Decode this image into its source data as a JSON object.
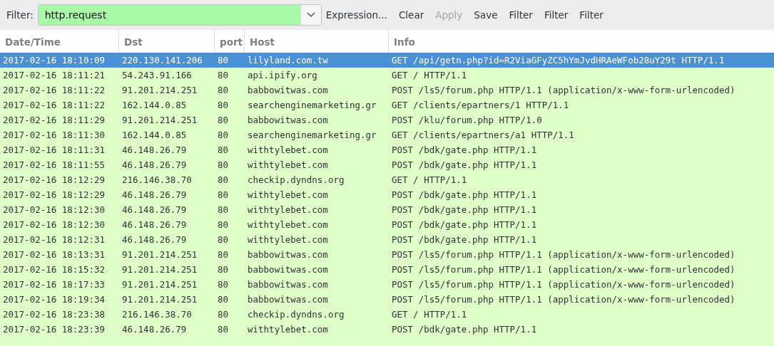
{
  "toolbar": {
    "label": "Filter:",
    "filter": {
      "value": "http.request",
      "valid": true
    },
    "buttons": [
      {
        "label": "Expression...",
        "disabled": false
      },
      {
        "label": "Clear",
        "disabled": false
      },
      {
        "label": "Apply",
        "disabled": true
      },
      {
        "label": "Save",
        "disabled": false
      },
      {
        "label": "Filter",
        "disabled": false
      },
      {
        "label": "Filter",
        "disabled": false
      },
      {
        "label": "Filter",
        "disabled": false
      }
    ]
  },
  "table": {
    "columns": [
      "Date/Time",
      "Dst",
      "port",
      "Host",
      "Info"
    ],
    "rows": [
      {
        "selected": true,
        "cells": [
          "2017-02-16 18:10:09",
          "220.130.141.206",
          "80",
          "lilyland.com.tw",
          "GET /api/getn.php?id=R2ViaGFyZC5hYmJvdHRAeWFob28uY29t HTTP/1.1"
        ]
      },
      {
        "selected": false,
        "cells": [
          "2017-02-16 18:11:21",
          "54.243.91.166",
          "80",
          "api.ipify.org",
          "GET / HTTP/1.1"
        ]
      },
      {
        "selected": false,
        "cells": [
          "2017-02-16 18:11:22",
          "91.201.214.251",
          "80",
          "babbowitwas.com",
          "POST /ls5/forum.php HTTP/1.1  (application/x-www-form-urlencoded)"
        ]
      },
      {
        "selected": false,
        "cells": [
          "2017-02-16 18:11:22",
          "162.144.0.85",
          "80",
          "searchenginemarketing.gr",
          "GET /clients/epartners/1 HTTP/1.1"
        ]
      },
      {
        "selected": false,
        "cells": [
          "2017-02-16 18:11:29",
          "91.201.214.251",
          "80",
          "babbowitwas.com",
          "POST /klu/forum.php HTTP/1.0"
        ]
      },
      {
        "selected": false,
        "cells": [
          "2017-02-16 18:11:30",
          "162.144.0.85",
          "80",
          "searchenginemarketing.gr",
          "GET /clients/epartners/a1 HTTP/1.1"
        ]
      },
      {
        "selected": false,
        "cells": [
          "2017-02-16 18:11:31",
          "46.148.26.79",
          "80",
          "withtylebet.com",
          "POST /bdk/gate.php HTTP/1.1"
        ]
      },
      {
        "selected": false,
        "cells": [
          "2017-02-16 18:11:55",
          "46.148.26.79",
          "80",
          "withtylebet.com",
          "POST /bdk/gate.php HTTP/1.1"
        ]
      },
      {
        "selected": false,
        "cells": [
          "2017-02-16 18:12:29",
          "216.146.38.70",
          "80",
          "checkip.dyndns.org",
          "GET / HTTP/1.1"
        ]
      },
      {
        "selected": false,
        "cells": [
          "2017-02-16 18:12:29",
          "46.148.26.79",
          "80",
          "withtylebet.com",
          "POST /bdk/gate.php HTTP/1.1"
        ]
      },
      {
        "selected": false,
        "cells": [
          "2017-02-16 18:12:30",
          "46.148.26.79",
          "80",
          "withtylebet.com",
          "POST /bdk/gate.php HTTP/1.1"
        ]
      },
      {
        "selected": false,
        "cells": [
          "2017-02-16 18:12:30",
          "46.148.26.79",
          "80",
          "withtylebet.com",
          "POST /bdk/gate.php HTTP/1.1"
        ]
      },
      {
        "selected": false,
        "cells": [
          "2017-02-16 18:12:31",
          "46.148.26.79",
          "80",
          "withtylebet.com",
          "POST /bdk/gate.php HTTP/1.1"
        ]
      },
      {
        "selected": false,
        "cells": [
          "2017-02-16 18:13:31",
          "91.201.214.251",
          "80",
          "babbowitwas.com",
          "POST /ls5/forum.php HTTP/1.1  (application/x-www-form-urlencoded)"
        ]
      },
      {
        "selected": false,
        "cells": [
          "2017-02-16 18:15:32",
          "91.201.214.251",
          "80",
          "babbowitwas.com",
          "POST /ls5/forum.php HTTP/1.1  (application/x-www-form-urlencoded)"
        ]
      },
      {
        "selected": false,
        "cells": [
          "2017-02-16 18:17:33",
          "91.201.214.251",
          "80",
          "babbowitwas.com",
          "POST /ls5/forum.php HTTP/1.1  (application/x-www-form-urlencoded)"
        ]
      },
      {
        "selected": false,
        "cells": [
          "2017-02-16 18:19:34",
          "91.201.214.251",
          "80",
          "babbowitwas.com",
          "POST /ls5/forum.php HTTP/1.1  (application/x-www-form-urlencoded)"
        ]
      },
      {
        "selected": false,
        "cells": [
          "2017-02-16 18:23:38",
          "216.146.38.70",
          "80",
          "checkip.dyndns.org",
          "GET / HTTP/1.1"
        ]
      },
      {
        "selected": false,
        "cells": [
          "2017-02-16 18:23:39",
          "46.148.26.79",
          "80",
          "withtylebet.com",
          "POST /bdk/gate.php HTTP/1.1"
        ]
      }
    ]
  }
}
